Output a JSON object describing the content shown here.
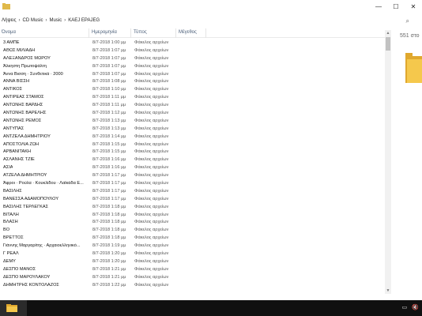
{
  "window": {
    "title": "",
    "controls": {
      "minimize": "—",
      "maximize": "☐",
      "close": "✕"
    }
  },
  "address": {
    "crumbs": [
      "Λήψεις",
      "CD Music",
      "Music",
      "KAEJ EPAJEG"
    ]
  },
  "columns": {
    "name": "Όνομα",
    "date": "Ημερομηνία",
    "type": "Τύπος",
    "size": "Μέγεθος"
  },
  "preview_text": "551 στο",
  "files": [
    {
      "name": "3 ΑΜΠΕ",
      "date": "8/7-2018 1:00 μμ",
      "type": "Φάκελος αρχείων"
    },
    {
      "name": "ΑΘΩΣ ΜΙΛΙΑΔΗ",
      "date": "8/7-2018 1:07 μμ",
      "type": "Φάκελος αρχείων"
    },
    {
      "name": "ΑΛΕΞΑΝΔΡΟΣ ΜΩΡΟΥ",
      "date": "8/7-2018 1:07 μμ",
      "type": "Φάκελος αρχείων"
    },
    {
      "name": "Άλκηστη Πρωτοψάλτη",
      "date": "8/7-2018 1:07 μμ",
      "type": "Φάκελος αρχείων"
    },
    {
      "name": "Άννα Βισση · Συνθετικά · 2000",
      "date": "8/7-2018 1:07 μμ",
      "type": "Φάκελος αρχείων"
    },
    {
      "name": "ΑΝΝΑ ΒΙΣΣΗ",
      "date": "8/7-2018 1:08 μμ",
      "type": "Φάκελος αρχείων"
    },
    {
      "name": "ΑΝΤΙΚΟΣ",
      "date": "8/7-2018 1:10 μμ",
      "type": "Φάκελος αρχείων"
    },
    {
      "name": "ΑΝΤΙΡΕΑΣ ΣΤΑΜΟΣ",
      "date": "8/7-2018 1:11 μμ",
      "type": "Φάκελος αρχείων"
    },
    {
      "name": "ΑΝΤΩΝΗΣ ΒΑΡΔΗΣ",
      "date": "8/7-2018 1:11 μμ",
      "type": "Φάκελος αρχείων"
    },
    {
      "name": "ΑΝΤΩΝΗΣ ΒΑΡΕΛΗΣ",
      "date": "8/7-2018 1:12 μμ",
      "type": "Φάκελος αρχείων"
    },
    {
      "name": "ΑΝΤΩΝΗΣ ΡΕΜΟΣ",
      "date": "8/7-2018 1:13 μμ",
      "type": "Φάκελος αρχείων"
    },
    {
      "name": "ΑΝΤΥΠΑΣ",
      "date": "8/7-2018 1:13 μμ",
      "type": "Φάκελος αρχείων"
    },
    {
      "name": "ΑΝΤΖΕΛΑ ΔΗΜΗΤΡΙΟΥ",
      "date": "8/7-2018 1:14 μμ",
      "type": "Φάκελος αρχείων"
    },
    {
      "name": "ΑΠΟΣΤΟΛΙΑ ΖΩΗ",
      "date": "8/7-2018 1:15 μμ",
      "type": "Φάκελος αρχείων"
    },
    {
      "name": "ΑΡΒΑΝΙΤΑΚΗ",
      "date": "8/7-2018 1:15 μμ",
      "type": "Φάκελος αρχείων"
    },
    {
      "name": "ΑΣΛΑΝΗΣ ΤΖΙΕ",
      "date": "8/7-2018 1:16 μμ",
      "type": "Φάκελος αρχείων"
    },
    {
      "name": "ΑΣΙΑ",
      "date": "8/7-2018 1:16 μμ",
      "type": "Φάκελος αρχείων"
    },
    {
      "name": "ΑΤΖΕΛΑ ΔΗΜΗΤΡΙΟΥ",
      "date": "8/7-2018 1:17 μμ",
      "type": "Φάκελος αρχείων"
    },
    {
      "name": "Άφροι · Ρούλα · Κουκλίδου · Λαϊκάδα Ε...",
      "date": "8/7-2018 1:17 μμ",
      "type": "Φάκελος αρχείων"
    },
    {
      "name": "ΒΑΣΙΛΗΣ",
      "date": "8/7-2018 1:17 μμ",
      "type": "Φάκελος αρχείων"
    },
    {
      "name": "ΒΑΝΕΣΣΑ ΑΔΑΜΟΠΟΥΛΟΥ",
      "date": "8/7-2018 1:17 μμ",
      "type": "Φάκελος αρχείων"
    },
    {
      "name": "ΒΑΣΙΛΗΣ ΤΕΡΛΕΓΚΑΣ",
      "date": "8/7-2018 1:18 μμ",
      "type": "Φάκελος αρχείων"
    },
    {
      "name": "ΒΙΤΑΛΗ",
      "date": "8/7-2018 1:18 μμ",
      "type": "Φάκελος αρχείων"
    },
    {
      "name": "ΒΛΑΣΗ",
      "date": "8/7-2018 1:18 μμ",
      "type": "Φάκελος αρχείων"
    },
    {
      "name": "ΒΟ",
      "date": "8/7-2018 1:18 μμ",
      "type": "Φάκελος αρχείων"
    },
    {
      "name": "ΒΡΕΤΤΟΣ",
      "date": "8/7-2018 1:18 μμ",
      "type": "Φάκελος αρχείων"
    },
    {
      "name": "Γιάννης Μαργαρίτης · Αρχαιοελληνικό...",
      "date": "8/7-2018 1:19 μμ",
      "type": "Φάκελος αρχείων"
    },
    {
      "name": "Γ ΡΕΑΛ",
      "date": "8/7-2018 1:20 μμ",
      "type": "Φάκελος αρχείων"
    },
    {
      "name": "ΔΕΜΥ",
      "date": "8/7-2018 1:20 μμ",
      "type": "Φάκελος αρχείων"
    },
    {
      "name": "ΔΕΣΠΟ ΜΑΝΟΣ",
      "date": "8/7-2018 1:21 μμ",
      "type": "Φάκελος αρχείων"
    },
    {
      "name": "ΔΕΣΠΟ ΜΑΡΟΥΛΑΚΟΥ",
      "date": "8/7-2018 1:21 μμ",
      "type": "Φάκελος αρχείων"
    },
    {
      "name": "ΔΗΜΗΤΡΗΣ ΚΟΝΤΟΛΑΖΟΣ",
      "date": "8/7-2018 1:22 μμ",
      "type": "Φάκελος αρχείων"
    }
  ],
  "taskbar": {
    "tray": [
      "▭",
      "🔇"
    ]
  },
  "colors": {
    "folder": "#f5c84c",
    "folder_dark": "#e0a82e",
    "taskbar": "#101010"
  }
}
